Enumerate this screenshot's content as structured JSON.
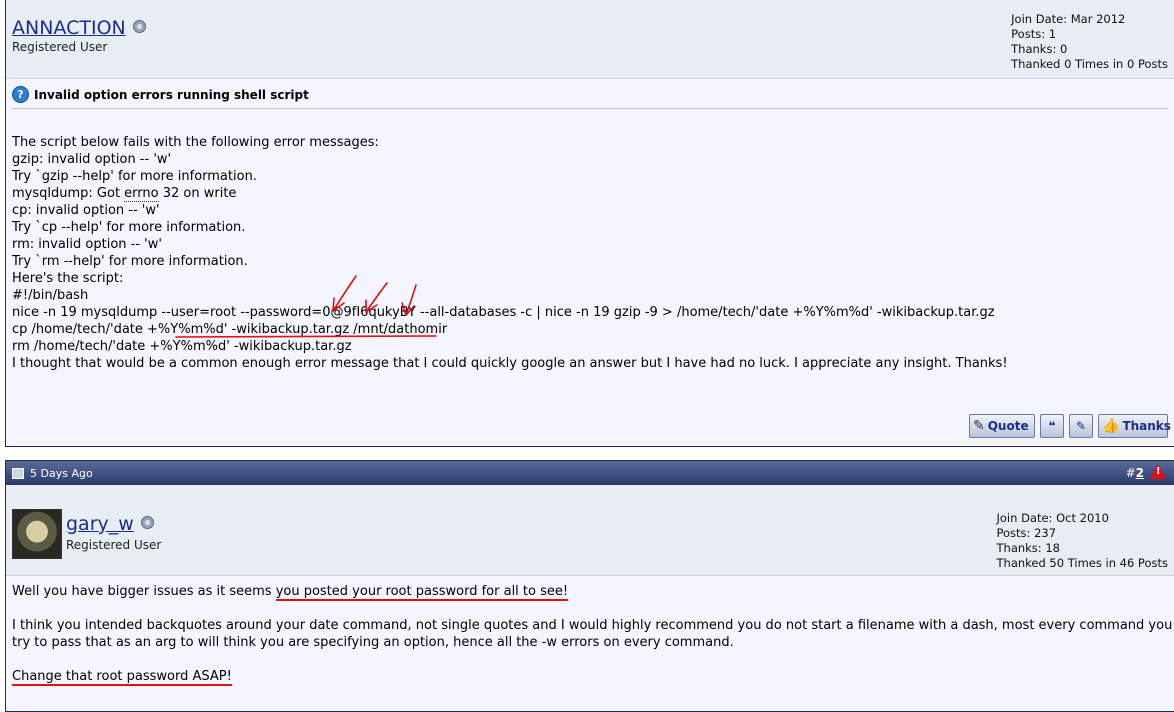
{
  "post1": {
    "username": "ANNACTION",
    "user_title": "Registered User",
    "stats": [
      "Join Date: Mar 2012",
      "Posts: 1",
      "Thanks: 0",
      "Thanked 0 Times in 0 Posts"
    ],
    "title": "Invalid option errors running shell script",
    "lines": [
      "The script below fails with the following error messages:",
      "gzip: invalid option -- 'w'",
      "Try `gzip --help' for more information.",
      "mysqldump: Got errno 32 on write",
      "cp: invalid option -- 'w'",
      "Try `cp --help' for more information.",
      "rm: invalid option -- 'w'",
      "Try `rm --help' for more information.",
      "",
      "Here's the script:",
      "",
      "#!/bin/bash",
      "nice -n 19 mysqldump --user=root --password=0@9fI6qukyBY --all-databases -c | nice -n 19 gzip -9 > /home/tech/'date +%Y%m%d' -wikibackup.tar.gz",
      "cp /home/tech/'date +%Y%m%d' -wikibackup.tar.gz /mnt/dathomir",
      "rm /home/tech/'date +%Y%m%d' -wikibackup.tar.gz",
      "",
      "I thought that would be a common enough error message that I could quickly google an answer but I have had no luck. I appreciate any insight. Thanks!"
    ],
    "buttons": {
      "quote": "Quote",
      "thanks": "Thanks"
    }
  },
  "post2": {
    "date": "5 Days Ago",
    "num_prefix": "#",
    "num": "2",
    "username": "gary_w",
    "user_title": "Registered User",
    "stats": [
      "Join Date: Oct 2010",
      "Posts: 237",
      "Thanks: 18",
      "Thanked 50 Times in 46 Posts"
    ],
    "p1_a": "Well you have bigger issues as it seems ",
    "p1_b": "you posted your root password for all to see!",
    "p2": "I think you intended backquotes around your date command, not single quotes and I would highly recommend you do not start a filename with a dash, most every command you try to pass that as an arg to will think you are specifying an option, hence all the -w errors on every command.",
    "p3": "Change that root password ASAP!"
  }
}
